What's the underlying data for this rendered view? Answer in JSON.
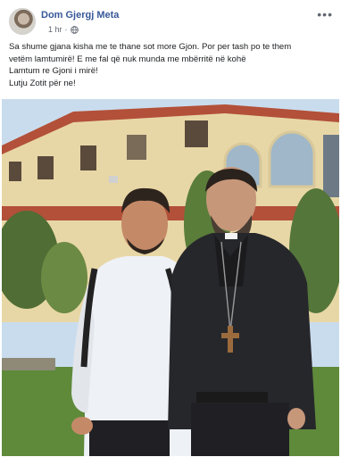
{
  "post": {
    "author": "Dom Gjergj Meta",
    "time": "1 hr",
    "privacy_icon": "globe-icon",
    "more_icon": "ellipsis-icon",
    "lines": [
      "Sa shume gjana kisha me te thane sot more Gjon. Por per tash po te them",
      "vetëm lamtumirë! E me fal që nuk munda me mbërritë në kohë",
      "Lamtum re Gjoni i mirë!",
      "Lutju Zotit për ne!"
    ]
  },
  "colors": {
    "author_link": "#385898",
    "sky": "#c9dcee",
    "building": "#e8d7a6",
    "roof": "#b2503a",
    "grass": "#5e8a3a"
  }
}
